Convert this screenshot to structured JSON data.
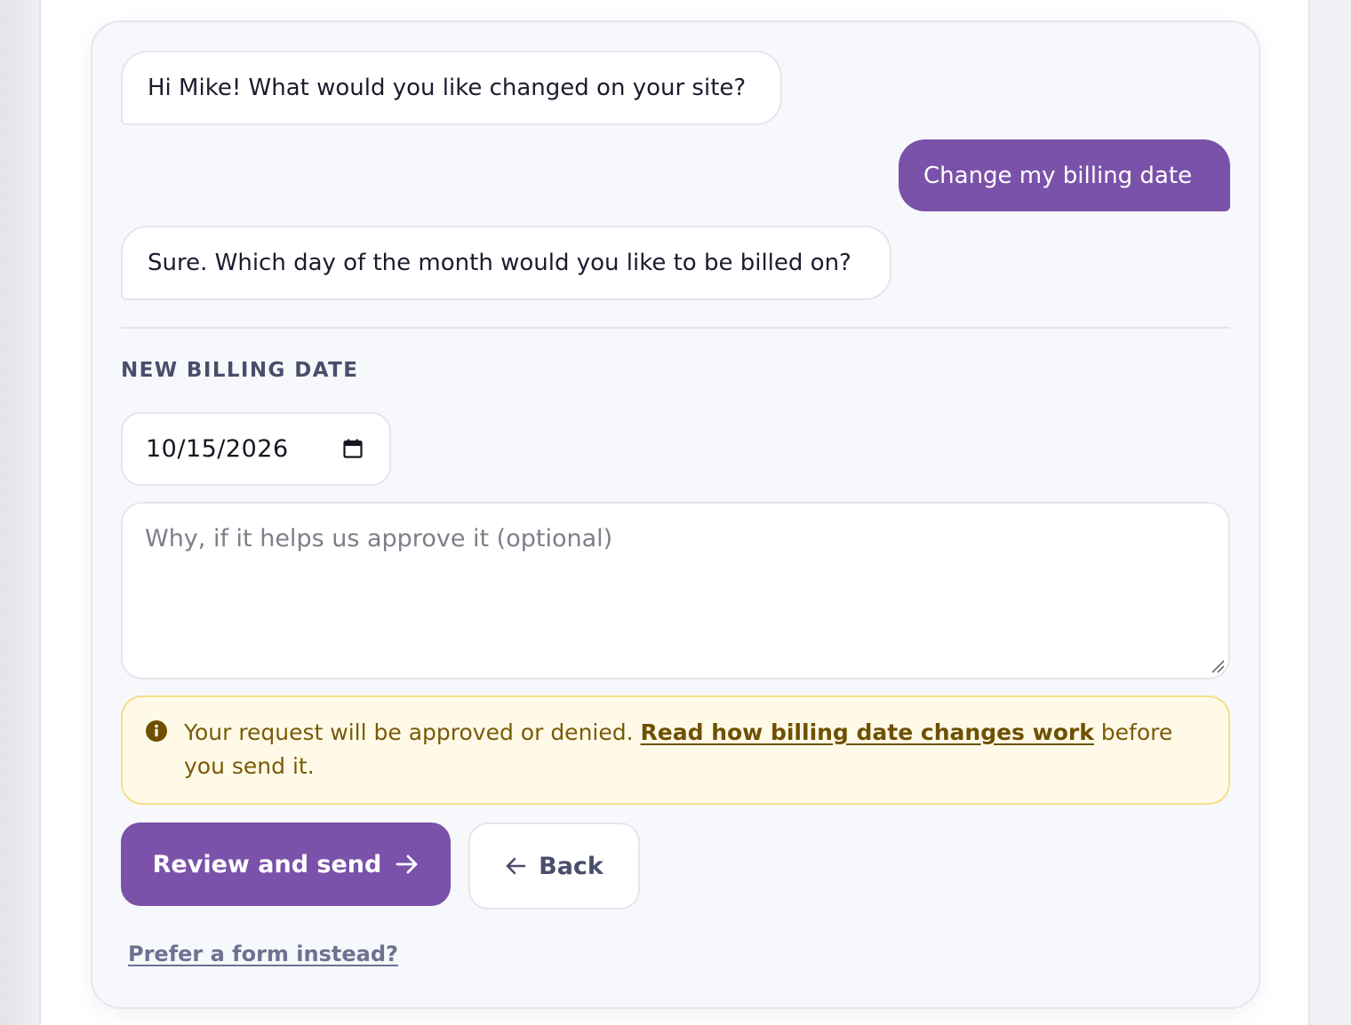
{
  "chat": {
    "messages": [
      {
        "role": "bot",
        "text": "Hi Mike! What would you like changed on your site?"
      },
      {
        "role": "user",
        "text": "Change my billing date"
      },
      {
        "role": "bot",
        "text": "Sure. Which day of the month would you like to be billed on?"
      }
    ]
  },
  "form": {
    "section_label": "NEW BILLING DATE",
    "date_value": "10/15/2026",
    "reason_placeholder": "Why, if it helps us approve it (optional)",
    "reason_value": ""
  },
  "notice": {
    "text_before": "Your request will be approved or denied. ",
    "link_text": "Read how billing date changes work",
    "text_after": " before you send it."
  },
  "actions": {
    "primary_label": "Review and send",
    "back_label": "Back",
    "form_link_label": "Prefer a form instead?"
  },
  "icons": {
    "calendar": "calendar-icon",
    "info": "info-icon",
    "arrow_right": "arrow-right-icon",
    "arrow_left": "arrow-left-icon",
    "resize": "resize-grip-icon"
  },
  "colors": {
    "accent": "#7a52a9",
    "notice_bg": "#fffae8",
    "notice_border": "#f6df8a",
    "notice_text": "#7a5a06"
  }
}
